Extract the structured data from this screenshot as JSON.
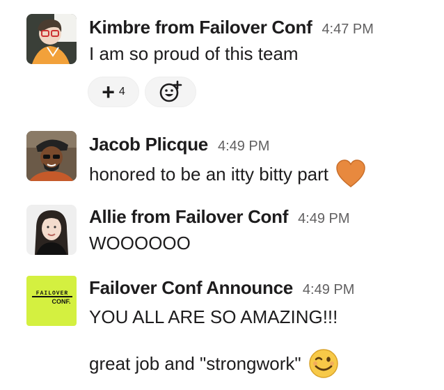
{
  "messages": [
    {
      "sender": "Kimbre from Failover Conf",
      "time": "4:47 PM",
      "text": "I am so proud of this team",
      "reactions": [
        {
          "emoji": "heavy-plus-icon",
          "symbol": "+",
          "count": "4"
        }
      ]
    },
    {
      "sender": "Jacob Plicque",
      "time": "4:49 PM",
      "text": "honored to be an itty bitty part",
      "emoji": "orange-heart-icon"
    },
    {
      "sender": "Allie from Failover Conf",
      "time": "4:49 PM",
      "text": "WOOOOOO"
    },
    {
      "sender": "Failover Conf Announce",
      "time": "4:49 PM",
      "text": "YOU ALL ARE SO AMAZING!!!",
      "text2": "great job and \"strongwork\"",
      "emoji": "winking-face-icon",
      "avatar_logo_top": "FAILOVER",
      "avatar_logo_bottom": "CONF."
    }
  ],
  "colors": {
    "logo_bg": "#d4f040",
    "heart": "#e8893e",
    "emoji_face": "#f7c948"
  }
}
